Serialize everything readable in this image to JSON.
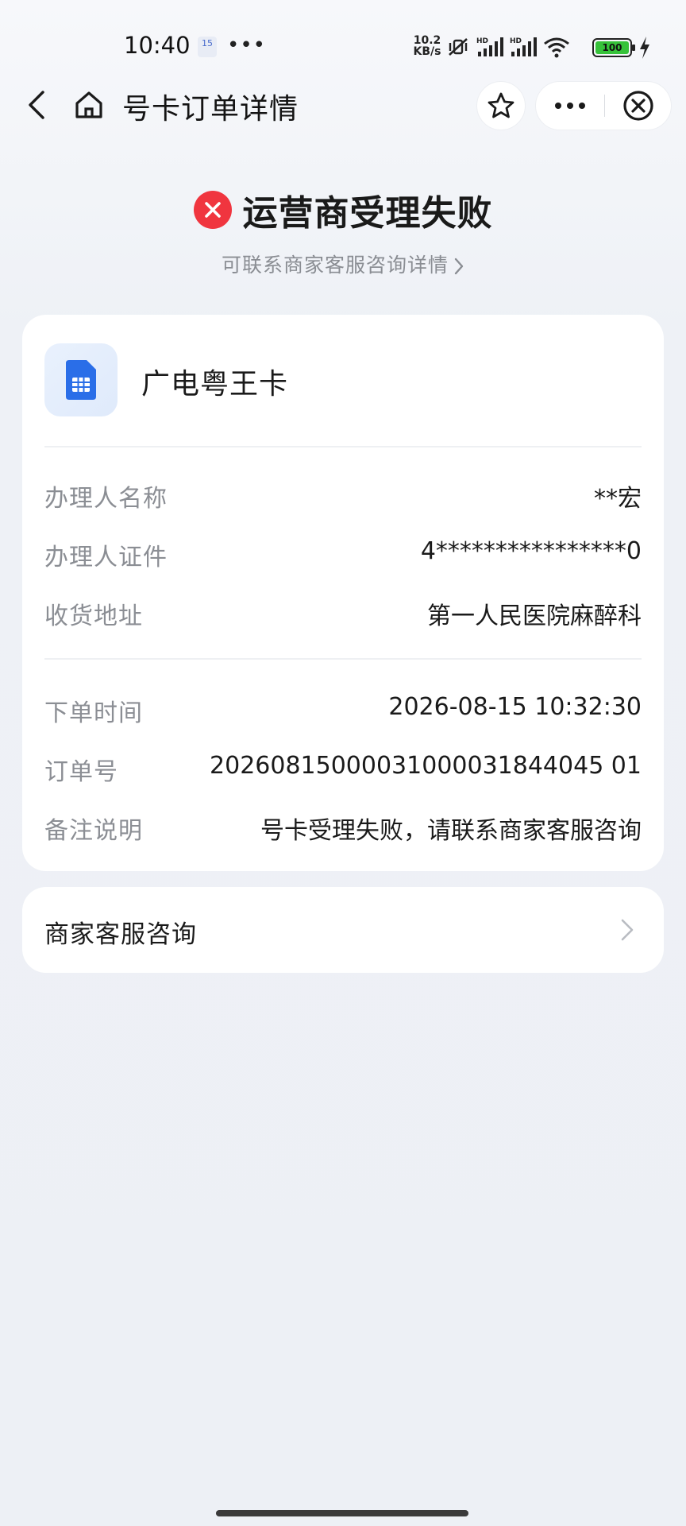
{
  "status_bar": {
    "time": "10:40",
    "calendar_day": "15",
    "notification_dots": "•••",
    "net_speed_value": "10.2",
    "net_speed_unit": "KB/s",
    "battery": "100"
  },
  "nav": {
    "title": "号卡订单详情"
  },
  "result": {
    "title": "运营商受理失败",
    "subtitle": "可联系商家客服咨询详情",
    "status_color": "#f0353f"
  },
  "product": {
    "name": "广电粤王卡",
    "icon": "sim-card-icon"
  },
  "details": {
    "applicant_name": {
      "label": "办理人名称",
      "value": "**宏"
    },
    "applicant_id": {
      "label": "办理人证件",
      "value": "4****************0"
    },
    "address": {
      "label": "收货地址",
      "value": "第一人民医院麻醉科"
    },
    "order_time": {
      "label": "下单时间",
      "value": "2026-08-15 10:32:30"
    },
    "order_no": {
      "label": "订单号",
      "value": "20260815000031000031844045 01"
    },
    "remark": {
      "label": "备注说明",
      "value": "号卡受理失败，请联系商家客服咨询"
    }
  },
  "service": {
    "label": "商家客服咨询"
  }
}
